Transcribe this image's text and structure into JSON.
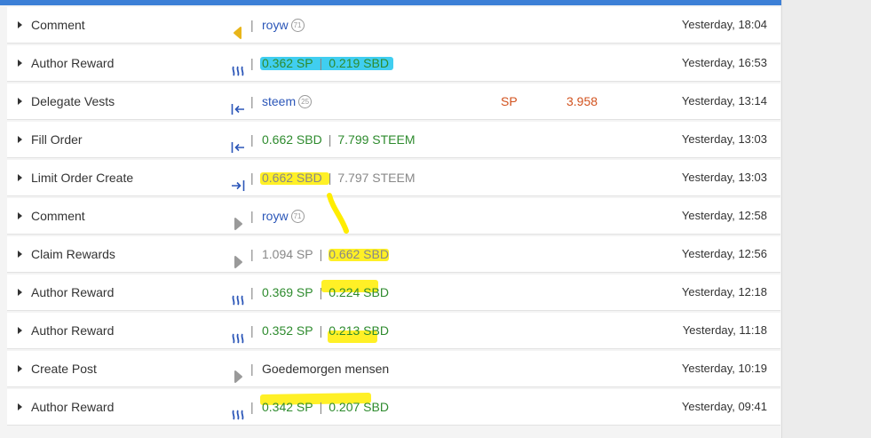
{
  "rows": [
    {
      "type": "Comment",
      "icon": "comment-icon",
      "parts": [
        {
          "text": "royw",
          "color": "blue"
        }
      ],
      "rep": "71",
      "time": "Yesterday, 18:04"
    },
    {
      "type": "Author Reward",
      "icon": "steem-logo-icon",
      "parts": [
        {
          "text": "0.362 SP",
          "color": "green"
        },
        {
          "text": "0.219 SBD",
          "color": "green"
        }
      ],
      "time": "Yesterday, 16:53"
    },
    {
      "type": "Delegate Vests",
      "icon": "enter-icon",
      "parts": [
        {
          "text": "steem",
          "color": "blue"
        }
      ],
      "rep": "25",
      "extra_label": "SP",
      "extra_value": "3.958",
      "time": "Yesterday, 13:14"
    },
    {
      "type": "Fill Order",
      "icon": "enter-icon",
      "parts": [
        {
          "text": "0.662 SBD",
          "color": "green"
        },
        {
          "text": "7.799 STEEM",
          "color": "green"
        }
      ],
      "time": "Yesterday, 13:03"
    },
    {
      "type": "Limit Order Create",
      "icon": "login-icon",
      "parts": [
        {
          "text": "0.662 SBD",
          "color": "gray"
        },
        {
          "text": "7.797 STEEM",
          "color": "gray"
        }
      ],
      "time": "Yesterday, 13:03"
    },
    {
      "type": "Comment",
      "icon": "play-icon",
      "parts": [
        {
          "text": "royw",
          "color": "blue"
        }
      ],
      "rep": "71",
      "time": "Yesterday, 12:58"
    },
    {
      "type": "Claim Rewards",
      "icon": "play-icon",
      "parts": [
        {
          "text": "1.094 SP",
          "color": "gray"
        },
        {
          "text": "0.662 SBD",
          "color": "gray"
        }
      ],
      "time": "Yesterday, 12:56"
    },
    {
      "type": "Author Reward",
      "icon": "steem-logo-icon",
      "parts": [
        {
          "text": "0.369 SP",
          "color": "green"
        },
        {
          "text": "0.224 SBD",
          "color": "green"
        }
      ],
      "time": "Yesterday, 12:18"
    },
    {
      "type": "Author Reward",
      "icon": "steem-logo-icon",
      "parts": [
        {
          "text": "0.352 SP",
          "color": "green"
        },
        {
          "text": "0.213 SBD",
          "color": "green"
        }
      ],
      "time": "Yesterday, 11:18"
    },
    {
      "type": "Create Post",
      "icon": "play-icon",
      "parts": [
        {
          "text": "Goedemorgen mensen",
          "color": "dark"
        }
      ],
      "time": "Yesterday, 10:19"
    },
    {
      "type": "Author Reward",
      "icon": "steem-logo-icon",
      "parts": [
        {
          "text": "0.342 SP",
          "color": "green"
        },
        {
          "text": "0.207 SBD",
          "color": "green"
        }
      ],
      "time": "Yesterday, 09:41"
    }
  ],
  "colors": {
    "green": "#2e8b2e",
    "blue": "#2b56b8",
    "gray": "#888888",
    "orange": "#d2521e",
    "accent": "#3c7fd6",
    "comment_icon": "#e8b51a",
    "highlight_yellow": "#ffed00",
    "highlight_cyan": "#00bee6"
  }
}
